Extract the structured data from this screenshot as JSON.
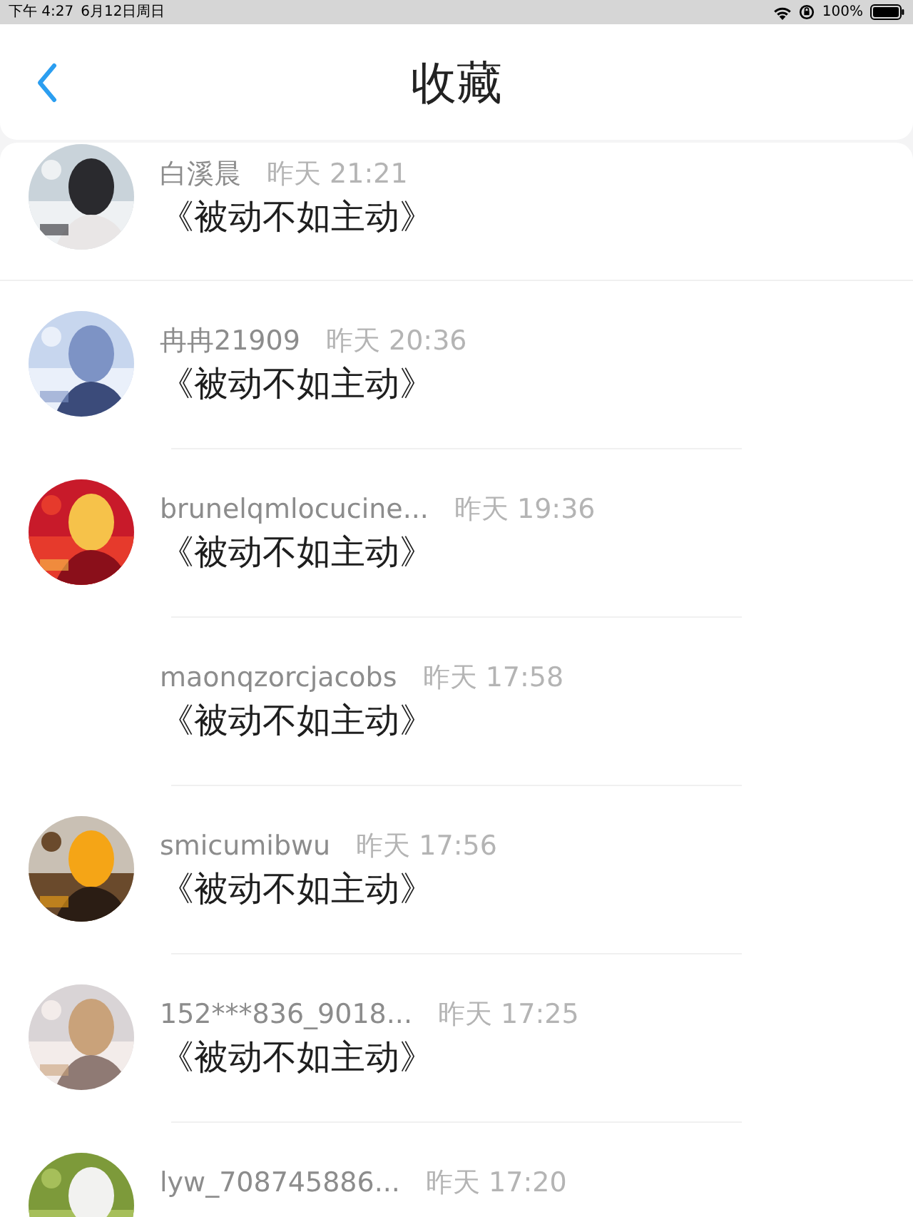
{
  "status_bar": {
    "time": "下午 4:27",
    "date": "6月12日周日",
    "battery": "100%"
  },
  "nav": {
    "title": "收藏"
  },
  "items": [
    {
      "name": "白溪晨",
      "time": "昨天 21:21",
      "title": "《被动不如主动》"
    },
    {
      "name": "冉冉21909",
      "time": "昨天 20:36",
      "title": "《被动不如主动》"
    },
    {
      "name": "brunelqmlocucine...",
      "time": "昨天 19:36",
      "title": "《被动不如主动》"
    },
    {
      "name": "maonqzorcjacobs",
      "time": "昨天 17:58",
      "title": "《被动不如主动》"
    },
    {
      "name": "smicumibwu",
      "time": "昨天 17:56",
      "title": "《被动不如主动》"
    },
    {
      "name": "152***836_9018...",
      "time": "昨天 17:25",
      "title": "《被动不如主动》"
    },
    {
      "name": "lyw_708745886...",
      "time": "昨天 17:20"
    }
  ]
}
